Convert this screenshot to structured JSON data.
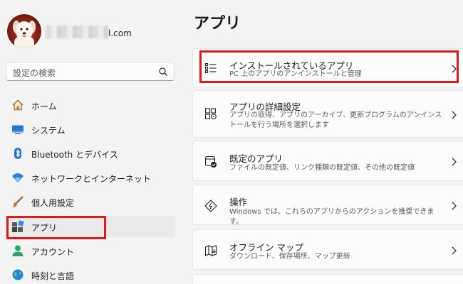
{
  "account": {
    "email_visible": "l.com",
    "avatar": "dog-avatar"
  },
  "search": {
    "placeholder": "設定の検索",
    "icon": "search-icon"
  },
  "nav": {
    "items": [
      {
        "label": "ホーム",
        "icon": "home-icon"
      },
      {
        "label": "システム",
        "icon": "system-icon"
      },
      {
        "label": "Bluetooth とデバイス",
        "icon": "bluetooth-icon"
      },
      {
        "label": "ネットワークとインターネット",
        "icon": "network-icon"
      },
      {
        "label": "個人用設定",
        "icon": "brush-icon"
      },
      {
        "label": "アプリ",
        "icon": "apps-icon",
        "selected": true
      },
      {
        "label": "アカウント",
        "icon": "account-icon"
      },
      {
        "label": "時刻と言語",
        "icon": "globe-icon"
      }
    ]
  },
  "main": {
    "title": "アプリ",
    "cards": [
      {
        "title": "インストールされているアプリ",
        "desc": "PC 上のアプリのアンインストールと管理",
        "icon": "installed-apps-icon"
      },
      {
        "title": "アプリの詳細設定",
        "desc": "アプリの取得、アプリのアーカイブ、更新プログラムのアンインストールを行う場所を選択します",
        "icon": "advanced-apps-icon"
      },
      {
        "title": "既定のアプリ",
        "desc": "ファイルの既定値、リンク種類の既定値、その他の既定値",
        "icon": "default-apps-icon"
      },
      {
        "title": "操作",
        "desc": "Windows では、これらのアプリからのアクションを推奨できます。",
        "icon": "actions-icon"
      },
      {
        "title": "オフライン マップ",
        "desc": "ダウンロード、保存場所、マップ更新",
        "icon": "offline-map-icon"
      }
    ]
  },
  "colors": {
    "highlight": "#e01818",
    "accent": "#0067c0"
  }
}
